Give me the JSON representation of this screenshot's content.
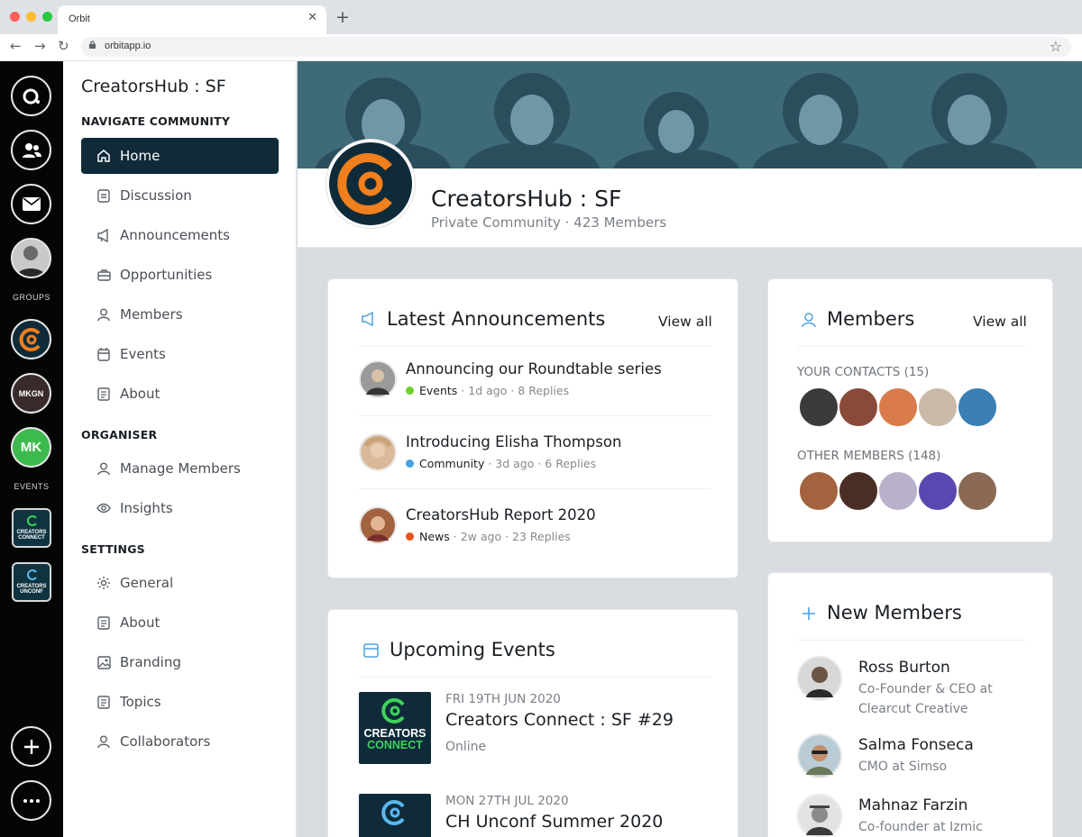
{
  "browser": {
    "tab_title": "Orbit",
    "url": "orbitapp.io"
  },
  "rail": {
    "groups_label": "GROUPS",
    "events_label": "EVENTS",
    "group_mk_text": "MKGN",
    "group_madein_text": "MK",
    "event1_text": "CREATORS CONNECT",
    "event2_text": "CREATORS UNCONF"
  },
  "sidebar": {
    "community_name": "CreatorsHub : SF",
    "navigate_title": "NAVIGATE COMMUNITY",
    "navigate_items": [
      {
        "label": "Home",
        "icon": "home-icon"
      },
      {
        "label": "Discussion",
        "icon": "discussion-icon"
      },
      {
        "label": "Announcements",
        "icon": "megaphone-icon"
      },
      {
        "label": "Opportunities",
        "icon": "briefcase-icon"
      },
      {
        "label": "Members",
        "icon": "person-icon"
      },
      {
        "label": "Events",
        "icon": "calendar-icon"
      },
      {
        "label": "About",
        "icon": "document-icon"
      }
    ],
    "organiser_title": "ORGANISER",
    "organiser_items": [
      {
        "label": "Manage Members",
        "icon": "person-icon"
      },
      {
        "label": "Insights",
        "icon": "eye-icon"
      }
    ],
    "settings_title": "SETTINGS",
    "settings_items": [
      {
        "label": "General",
        "icon": "gear-icon"
      },
      {
        "label": "About",
        "icon": "document-icon"
      },
      {
        "label": "Branding",
        "icon": "image-icon"
      },
      {
        "label": "Topics",
        "icon": "document-icon"
      },
      {
        "label": "Collaborators",
        "icon": "person-icon"
      }
    ]
  },
  "header": {
    "title": "CreatorsHub : SF",
    "subtitle": "Private Community · 423 Members"
  },
  "announcements": {
    "title": "Latest Announcements",
    "view_all": "View all",
    "items": [
      {
        "title": "Announcing our Roundtable series",
        "category": "Events",
        "category_color": "#6fcf2c",
        "meta": " · 1d ago · 8 Replies"
      },
      {
        "title": "Introducing Elisha Thompson",
        "category": "Community",
        "category_color": "#4aa3df",
        "meta": " · 3d ago · 6 Replies"
      },
      {
        "title": "CreatorsHub Report 2020",
        "category": "News",
        "category_color": "#e8541c",
        "meta": " · 2w ago · 23 Replies"
      }
    ]
  },
  "members": {
    "title": "Members",
    "view_all": "View all",
    "contacts_label": "YOUR CONTACTS (15)",
    "others_label": "OTHER MEMBERS (148)"
  },
  "events": {
    "title": "Upcoming Events",
    "items": [
      {
        "date": "FRI 19TH JUN 2020",
        "name": "Creators Connect : SF #29",
        "location": "Online",
        "thumb_top": "CREATORS",
        "thumb_bottom": "CONNECT"
      },
      {
        "date": "MON 27TH JUL 2020",
        "name": "CH Unconf Summer 2020",
        "location": "",
        "thumb_top": "",
        "thumb_bottom": ""
      }
    ]
  },
  "new_members": {
    "title": "New Members",
    "items": [
      {
        "name": "Ross Burton",
        "role": "Co-Founder & CEO at Clearcut Creative"
      },
      {
        "name": "Salma Fonseca",
        "role": "CMO at Simso"
      },
      {
        "name": "Mahnaz Farzin",
        "role": "Co-founder at Izmic"
      }
    ]
  },
  "colors": {
    "accent_dark": "#0f2b3a",
    "brand_orange": "#f07f1e"
  }
}
